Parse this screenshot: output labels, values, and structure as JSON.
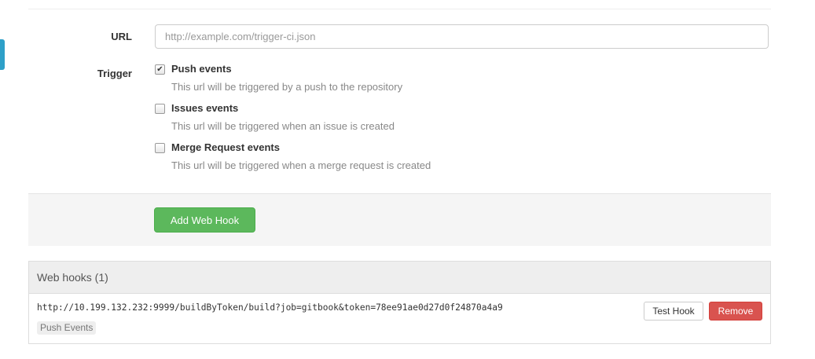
{
  "form": {
    "url_label": "URL",
    "url_placeholder": "http://example.com/trigger-ci.json",
    "url_value": "",
    "trigger_label": "Trigger",
    "options": [
      {
        "label": "Push events",
        "description": "This url will be triggered by a push to the repository",
        "checked": true
      },
      {
        "label": "Issues events",
        "description": "This url will be triggered when an issue is created",
        "checked": false
      },
      {
        "label": "Merge Request events",
        "description": "This url will be triggered when a merge request is created",
        "checked": false
      }
    ],
    "submit_label": "Add Web Hook"
  },
  "hooks_panel": {
    "heading": "Web hooks (1)",
    "hooks": [
      {
        "url": "http://10.199.132.232:9999/buildByToken/build?job=gitbook&token=78ee91ae0d27d0f24870a4a9",
        "events_badge": "Push Events",
        "test_label": "Test Hook",
        "remove_label": "Remove"
      }
    ]
  },
  "colors": {
    "accent_tab": "#2ea0c8",
    "success": "#5cb85c",
    "danger": "#d9534f"
  },
  "icons": {
    "checkmark": "check-icon"
  }
}
